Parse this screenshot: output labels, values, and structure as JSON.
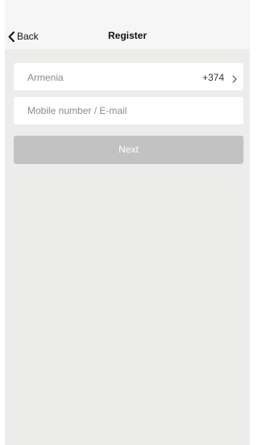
{
  "navbar": {
    "back_label": "Back",
    "title": "Register",
    "back_icon": "chevron-left-icon"
  },
  "form": {
    "country": {
      "name": "Armenia",
      "code": "+374",
      "icon": "chevron-right-icon"
    },
    "contact": {
      "value": "",
      "placeholder": "Mobile number / E-mail"
    },
    "next_label": "Next",
    "next_enabled": false
  },
  "colors": {
    "page_background": "#ececeb",
    "navbar_background": "#f6f6f6",
    "disabled_button": "#c2c2c2"
  }
}
